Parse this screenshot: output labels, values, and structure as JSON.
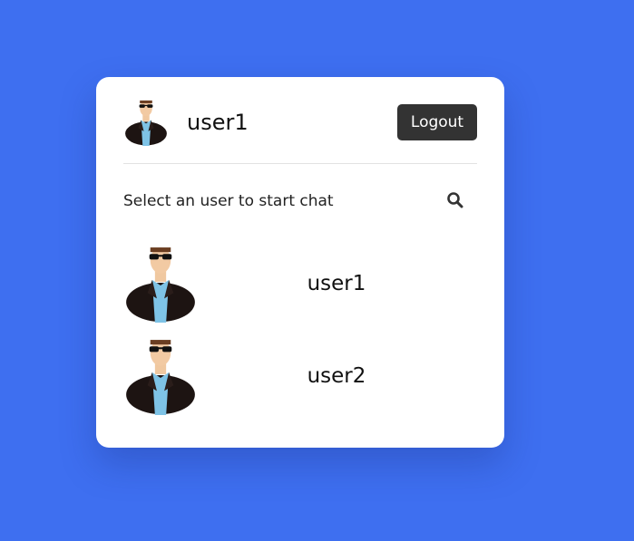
{
  "header": {
    "username": "user1",
    "logout_label": "Logout"
  },
  "search": {
    "prompt": "Select an user to start chat",
    "icon": "search-icon"
  },
  "users": [
    {
      "name": "user1"
    },
    {
      "name": "user2"
    }
  ],
  "colors": {
    "background": "#3e6ff0",
    "card": "#ffffff",
    "logout_button": "#333333"
  }
}
